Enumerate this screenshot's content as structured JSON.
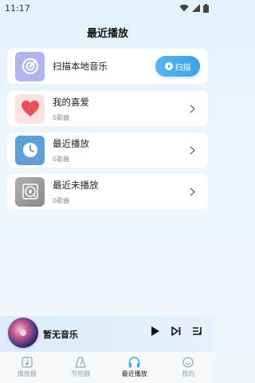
{
  "status": {
    "time": "11:17"
  },
  "page": {
    "title": "最近播放"
  },
  "scan_card": {
    "label": "扫描本地音乐",
    "button_label": "扫描"
  },
  "lists": [
    {
      "title": "我的喜爱",
      "sub": "0歌曲",
      "icon": "heart-icon",
      "tile_color": "#fde2e2",
      "icon_color": "#e8505b"
    },
    {
      "title": "最近播放",
      "sub": "0歌曲",
      "icon": "clock-icon",
      "tile_color": "#5f9fd8",
      "icon_color": "#ffffff"
    },
    {
      "title": "最近未播放",
      "sub": "0歌曲",
      "icon": "vinyl-icon",
      "tile_color": "#9a9a9a",
      "icon_color": "#ffffff"
    }
  ],
  "player": {
    "title": "暂无音乐"
  },
  "nav": [
    {
      "label": "播放器",
      "icon": "music-note-icon",
      "active": false
    },
    {
      "label": "节拍器",
      "icon": "metronome-icon",
      "active": false
    },
    {
      "label": "最近播放",
      "icon": "headphones-icon",
      "active": true
    },
    {
      "label": "我的",
      "icon": "smile-icon",
      "active": false
    }
  ],
  "colors": {
    "accent": "#3ea2e6",
    "background": "#e3f2fd"
  }
}
